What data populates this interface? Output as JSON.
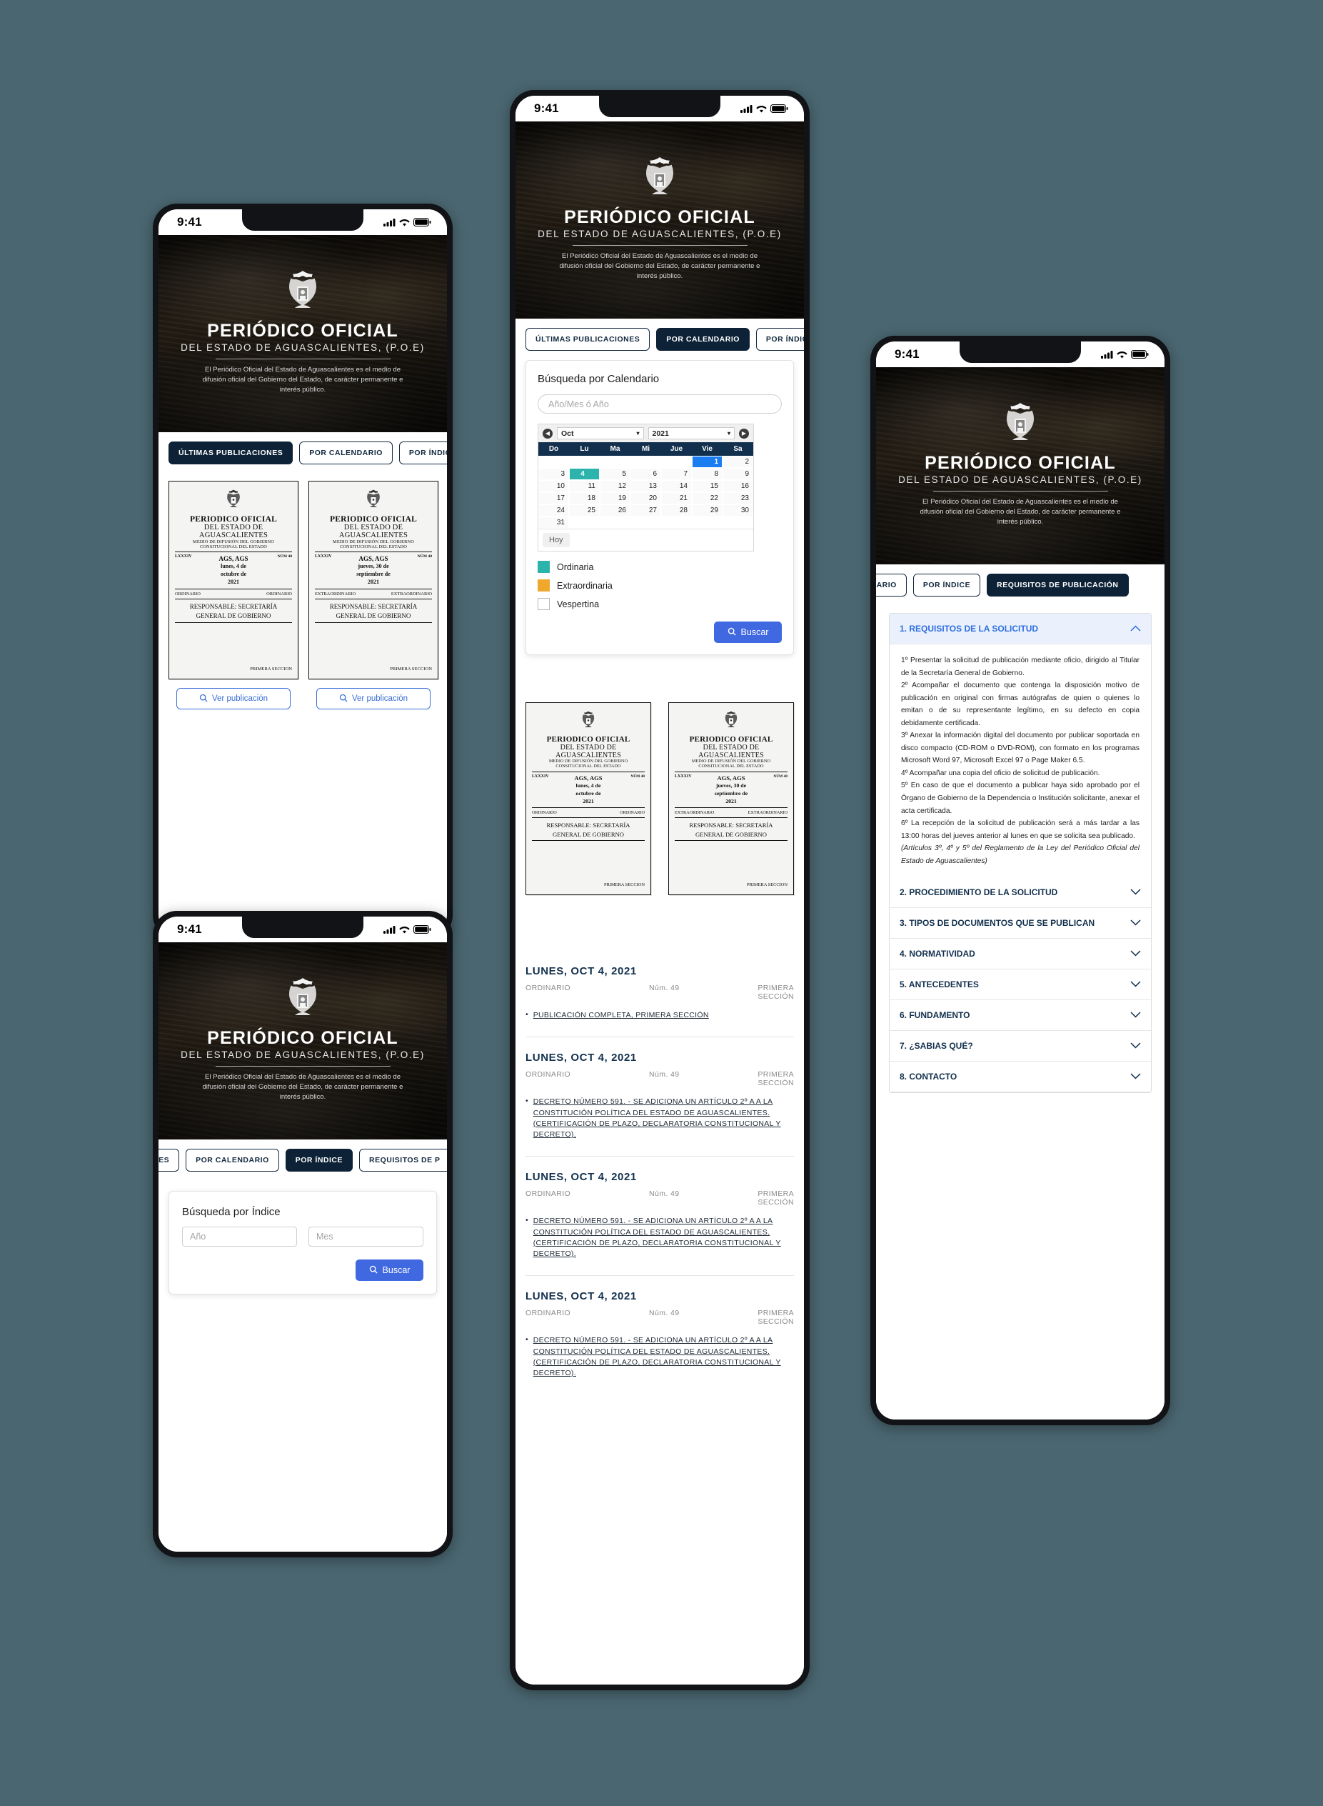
{
  "status": {
    "time": "9:41",
    "signal_icon": "cellular-signal-icon",
    "wifi_icon": "wifi-icon",
    "battery_icon": "battery-icon"
  },
  "hero": {
    "title": "PERIÓDICO OFICIAL",
    "subtitle": "DEL ESTADO DE AGUASCALIENTES, (P.O.E)",
    "description": "El Periódico Oficial del Estado de Aguascalientes es el medio de difusión oficial del Gobierno del Estado, de carácter permanente e interés público.",
    "crest_icon": "state-coat-of-arms-icon"
  },
  "tabs": {
    "ultimas": "ÚLTIMAS PUBLICACIONES",
    "calendario": "POR CALENDARIO",
    "indice": "POR ÍNDICE",
    "requisitos": "REQUISITOS DE PUBLICACIÓN",
    "ultimas_short": "NES",
    "calendario_short": "LENDARIO",
    "indice_short": "POR ÍND",
    "requisitos_short": "REQUISITOS DE P"
  },
  "publication_card_ordinaria": {
    "crest_icon": "state-coat-of-arms-icon",
    "line1": "PERIODICO OFICIAL",
    "line2": "DEL ESTADO DE",
    "line3": "AGUASCALIENTES",
    "line4": "MEDIO DE DIFUSIÓN DEL GOBIERNO",
    "line5": "CONSITUCIONAL DEL ESTADO",
    "volume": "LXXXIV",
    "place": "AGS, AGS",
    "date_line1": "lunes, 4 de",
    "date_line2": "octubre de",
    "date_line3": "2021",
    "num": "NÚM 40",
    "kind_left": "ORDINARIO",
    "kind_right": "ORDINARIO",
    "responsible1": "RESPONSABLE: SECRETARÍA",
    "responsible2": "GENERAL DE GOBIERNO",
    "section": "PRIMERA SECCION",
    "button": "Ver publicación",
    "button_icon": "search-icon"
  },
  "publication_card_extraordinaria": {
    "crest_icon": "state-coat-of-arms-icon",
    "line1": "PERIODICO OFICIAL",
    "line2": "DEL ESTADO DE",
    "line3": "AGUASCALIENTES",
    "line4": "MEDIO DE DIFUSIÓN DEL GOBIERNO",
    "line5": "CONSITUCIONAL DEL ESTADO",
    "volume": "LXXXIV",
    "place": "AGS, AGS",
    "date_line1": "jueves, 30 de",
    "date_line2": "septiembre de",
    "date_line3": "2021",
    "num": "NÚM 40",
    "kind_left": "EXTRAORDINARIO",
    "kind_right": "EXTRAORDINARIO",
    "responsible1": "RESPONSABLE: SECRETARÍA",
    "responsible2": "GENERAL DE GOBIERNO",
    "section": "PRIMERA SECCION",
    "button": "Ver publicación",
    "button_icon": "search-icon"
  },
  "calendar_search": {
    "title": "Búsqueda por Calendario",
    "input_placeholder": "Año/Mes ó Año",
    "input_value": "",
    "month": "Oct",
    "year": "2021",
    "prev_icon": "prev-arrow-icon",
    "next_icon": "next-arrow-icon",
    "dow": [
      "Do",
      "Lu",
      "Ma",
      "Mi",
      "Jue",
      "Vie",
      "Sa"
    ],
    "leading_blanks": 5,
    "days": [
      1,
      2,
      3,
      4,
      5,
      6,
      7,
      8,
      9,
      10,
      11,
      12,
      13,
      14,
      15,
      16,
      17,
      18,
      19,
      20,
      21,
      22,
      23,
      24,
      25,
      26,
      27,
      28,
      29,
      30,
      31
    ],
    "day_selected_blue": 1,
    "day_selected_teal": 4,
    "today_label": "Hoy",
    "legend": [
      {
        "label": "Ordinaria",
        "color": "#2bb3ac"
      },
      {
        "label": "Extraordinaria",
        "color": "#efa82c"
      },
      {
        "label": "Vespertina",
        "color": "#ffffff"
      }
    ],
    "search_button": "Buscar",
    "search_icon": "search-icon"
  },
  "index_search": {
    "title": "Búsqueda por Índice",
    "year_placeholder": "Año",
    "year_value": "",
    "month_placeholder": "Mes",
    "month_value": "",
    "search_button": "Buscar",
    "search_icon": "search-icon"
  },
  "publication_list": [
    {
      "date": "LUNES, OCT 4, 2021",
      "kind": "ORDINARIO",
      "num": "Núm. 49",
      "section_l1": "PRIMERA",
      "section_l2": "SECCIÓN",
      "entries": [
        "PUBLICACIÓN COMPLETA, PRIMERA SECCIÓN"
      ]
    },
    {
      "date": "LUNES, OCT 4, 2021",
      "kind": "ORDINARIO",
      "num": "Núm. 49",
      "section_l1": "PRIMERA",
      "section_l2": "SECCIÓN",
      "entries": [
        "DECRETO NÚMERO 591. - SE ADICIONA UN ARTÍCULO 2º A A LA CONSTITUCIÓN POLÍTICA DEL ESTADO DE AGUASCALIENTES. (CERTIFICACIÓN DE PLAZO, DECLARATORIA CONSTITUCIONAL Y DECRETO)."
      ]
    },
    {
      "date": "LUNES, OCT 4, 2021",
      "kind": "ORDINARIO",
      "num": "Núm. 49",
      "section_l1": "PRIMERA",
      "section_l2": "SECCIÓN",
      "entries": [
        "DECRETO NÚMERO 591. - SE ADICIONA UN ARTÍCULO 2º A A LA CONSTITUCIÓN POLÍTICA DEL ESTADO DE AGUASCALIENTES. (CERTIFICACIÓN DE PLAZO, DECLARATORIA CONSTITUCIONAL Y DECRETO)."
      ]
    },
    {
      "date": "LUNES, OCT 4, 2021",
      "kind": "ORDINARIO",
      "num": "Núm. 49",
      "section_l1": "PRIMERA",
      "section_l2": "SECCIÓN",
      "entries": [
        "DECRETO NÚMERO 591. - SE ADICIONA UN ARTÍCULO 2º A A LA CONSTITUCIÓN POLÍTICA DEL ESTADO DE AGUASCALIENTES. (CERTIFICACIÓN DE PLAZO, DECLARATORIA CONSTITUCIONAL Y DECRETO)."
      ]
    }
  ],
  "requirements_accordion": {
    "open_item": {
      "title": "1. REQUISITOS DE LA SOLICITUD",
      "chevron_icon": "chevron-up-icon",
      "paragraphs": [
        "1º Presentar la solicitud de publicación mediante oficio, dirigido al Titular de la Secretaría General de Gobierno.",
        "2º Acompañar el documento que contenga la disposición motivo de publicación en original con firmas autógrafas de quien o quienes lo emitan o de su representante legítimo, en su defecto en copia debidamente certificada.",
        "3º Anexar la información digital del documento por publicar soportada en disco compacto (CD-ROM o DVD-ROM), con formato en los programas Microsoft Word 97, Microsoft Excel 97 o Page Maker 6.5.",
        "4º Acompañar una copia del oficio de solicitud de publicación.",
        "5º En caso de que el documento a publicar haya sido aprobado por el Órgano de Gobierno de la Dependencia o Institución solicitante, anexar el acta certificada.",
        "6º La recepción de la solicitud de publicación será a más tardar a las 13:00 horas del jueves anterior al lunes en que se solicita sea publicado."
      ],
      "note": "(Artículos 3º, 4º y 5º del Reglamento de la Ley del Periódico Oficial del Estado de Aguascalientes)"
    },
    "items": [
      {
        "title": "2. PROCEDIMIENTO DE LA SOLICITUD",
        "chevron_icon": "chevron-down-icon"
      },
      {
        "title": "3. TIPOS DE DOCUMENTOS QUE SE PUBLICAN",
        "chevron_icon": "chevron-down-icon"
      },
      {
        "title": "4. NORMATIVIDAD",
        "chevron_icon": "chevron-down-icon"
      },
      {
        "title": "5. ANTECEDENTES",
        "chevron_icon": "chevron-down-icon"
      },
      {
        "title": "6. FUNDAMENTO",
        "chevron_icon": "chevron-down-icon"
      },
      {
        "title": "7. ¿SABIAS QUÉ?",
        "chevron_icon": "chevron-down-icon"
      },
      {
        "title": "8. CONTACTO",
        "chevron_icon": "chevron-down-icon"
      }
    ]
  },
  "colors": {
    "navy": "#12304d",
    "dark_navy": "#0d2236",
    "accent_blue": "#4068e0",
    "link_blue": "#2f6fe0",
    "teal": "#2bb3ac",
    "orange": "#efa82c",
    "page_bg": "#4a6670"
  }
}
